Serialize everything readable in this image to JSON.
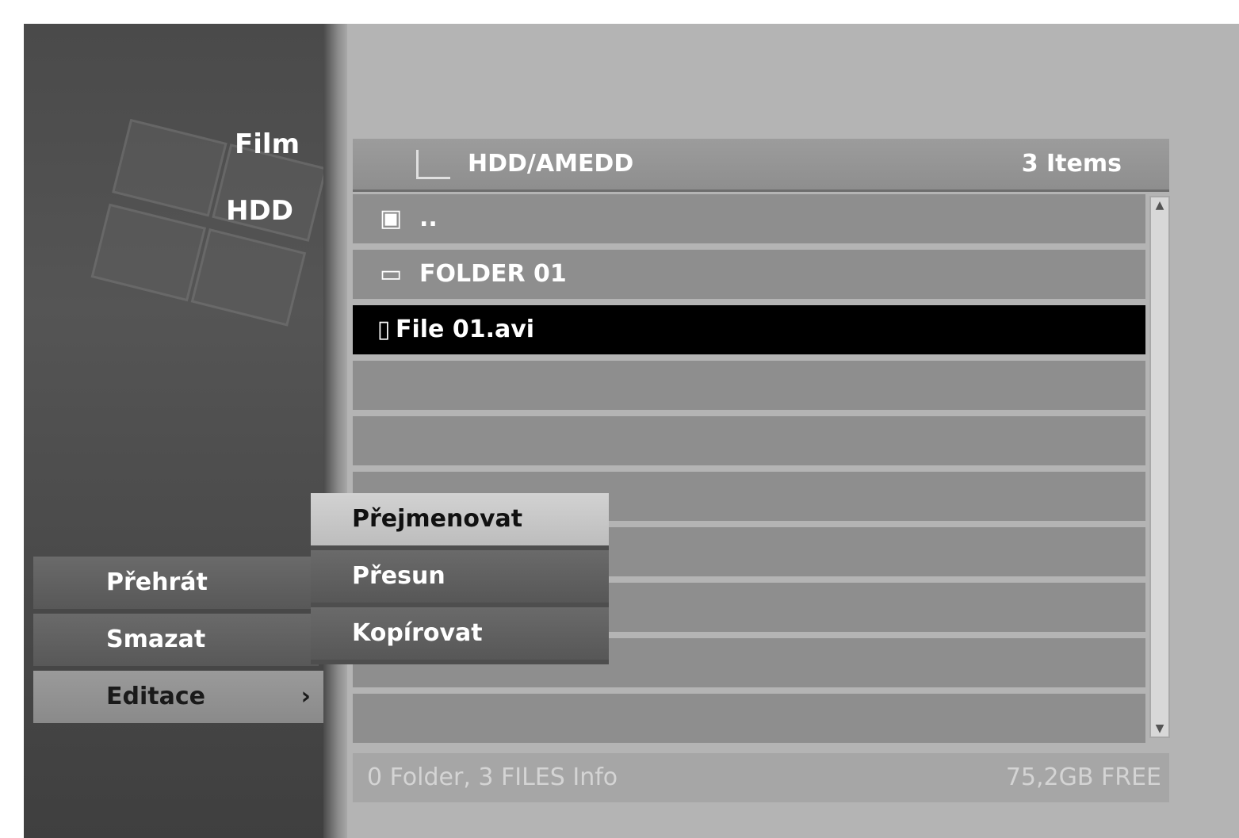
{
  "side_panel": {
    "labels": [
      "Film",
      "HDD"
    ]
  },
  "main_menu": {
    "items": [
      {
        "label": "Přehrát"
      },
      {
        "label": "Smazat"
      },
      {
        "label": "Editace",
        "arrow": "›"
      }
    ]
  },
  "sub_menu": {
    "items": [
      {
        "label": "Přejmenovat"
      },
      {
        "label": "Přesun"
      },
      {
        "label": "Kopírovat"
      }
    ]
  },
  "browser": {
    "path": "HDD/AMEDD",
    "item_count": "3 Items",
    "rows": [
      {
        "icon": "parent-folder-icon",
        "glyph": "▣",
        "label": ".."
      },
      {
        "icon": "folder-icon",
        "glyph": "▭",
        "label": "FOLDER 01"
      },
      {
        "icon": "file-icon",
        "glyph": "▯",
        "label": "File 01.avi"
      }
    ]
  },
  "footer": {
    "left": "0 Folder, 3 FILES Info",
    "right": "75,2GB FREE"
  },
  "colors": {
    "selection": "#000000",
    "highlight": "#c8c8c8"
  }
}
